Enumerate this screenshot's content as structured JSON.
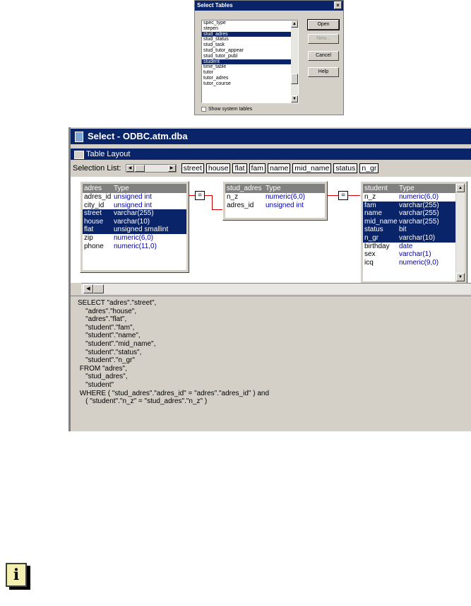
{
  "select_tables_dialog": {
    "title": "Select Tables",
    "close": "×",
    "tables": [
      {
        "label": "spec_type",
        "selected": false
      },
      {
        "label": "stepen",
        "selected": false
      },
      {
        "label": "stud_adres",
        "selected": true
      },
      {
        "label": "stud_status",
        "selected": false
      },
      {
        "label": "stud_task",
        "selected": false
      },
      {
        "label": "stud_tutor_appear",
        "selected": false
      },
      {
        "label": "stud_tutor_publ",
        "selected": false
      },
      {
        "label": "student",
        "selected": true
      },
      {
        "label": "time_table",
        "selected": false
      },
      {
        "label": "tutor",
        "selected": false
      },
      {
        "label": "tutor_adres",
        "selected": false
      },
      {
        "label": "tutor_course",
        "selected": false
      }
    ],
    "buttons": {
      "open": "Open",
      "new": "New...",
      "cancel": "Cancel",
      "help": "Help"
    },
    "show_system_tables": "Show system tables"
  },
  "select_window": {
    "title": "Select - ODBC.atm.dba",
    "subwindow_title": "Table Layout",
    "selection_list_label": "Selection List:",
    "selection_items": [
      "street",
      "house",
      "flat",
      "fam",
      "name",
      "mid_name",
      "status",
      "n_gr"
    ],
    "tables": [
      {
        "name": "adres",
        "type_header": "Type",
        "columns": [
          {
            "name": "adres_id",
            "type": "unsigned int",
            "selected": false
          },
          {
            "name": "city_id",
            "type": "unsigned int",
            "selected": false
          },
          {
            "name": "street",
            "type": "varchar(255)",
            "selected": true
          },
          {
            "name": "house",
            "type": "varchar(10)",
            "selected": true
          },
          {
            "name": "flat",
            "type": "unsigned smallint",
            "selected": true
          },
          {
            "name": "zip",
            "type": "numeric(6,0)",
            "selected": false
          },
          {
            "name": "phone",
            "type": "numeric(11,0)",
            "selected": false
          }
        ]
      },
      {
        "name": "stud_adres",
        "type_header": "Type",
        "columns": [
          {
            "name": "n_z",
            "type": "numeric(6,0)",
            "selected": false
          },
          {
            "name": "adres_id",
            "type": "unsigned int",
            "selected": false
          }
        ]
      },
      {
        "name": "student",
        "type_header": "Type",
        "columns": [
          {
            "name": "n_z",
            "type": "numeric(6,0)",
            "selected": false
          },
          {
            "name": "fam",
            "type": "varchar(255)",
            "selected": true
          },
          {
            "name": "name",
            "type": "varchar(255)",
            "selected": true
          },
          {
            "name": "mid_name",
            "type": "varchar(255)",
            "selected": true
          },
          {
            "name": "status",
            "type": "bit",
            "selected": true
          },
          {
            "name": "n_gr",
            "type": "varchar(10)",
            "selected": true
          },
          {
            "name": "birthday",
            "type": "date",
            "selected": false
          },
          {
            "name": "sex",
            "type": "varchar(1)",
            "selected": false
          },
          {
            "name": "icq",
            "type": "numeric(9,0)",
            "selected": false
          }
        ]
      }
    ],
    "join_symbol": "=",
    "sql": [
      "SELECT \"adres\".\"street\",",
      "    \"adres\".\"house\",",
      "    \"adres\".\"flat\",",
      "    \"student\".\"fam\",",
      "    \"student\".\"name\",",
      "    \"student\".\"mid_name\",",
      "    \"student\".\"status\",",
      "    \"student\".\"n_gr\"",
      " FROM \"adres\",",
      "    \"stud_adres\",",
      "    \"student\"",
      " WHERE ( \"stud_adres\".\"adres_id\" = \"adres\".\"adres_id\" ) and",
      "    ( \"student\".\"n_z\" = \"stud_adres\".\"n_z\" )"
    ]
  },
  "note_icon": {
    "glyph": "ℹ",
    "icon": "info-note-icon"
  },
  "colors": {
    "selection": "#0a246a",
    "dialog_face": "#d4d0c8",
    "type_text": "#0000b0",
    "join_line": "#cc0000",
    "note_bg": "#f2efb0"
  }
}
